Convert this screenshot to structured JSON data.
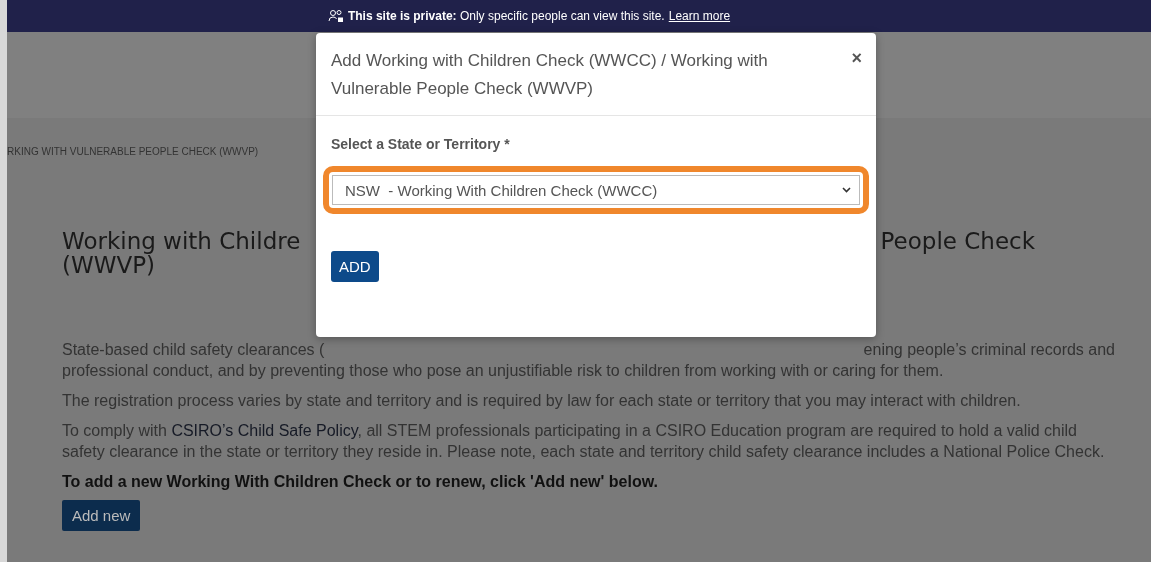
{
  "banner": {
    "bold": "This site is private:",
    "text": "Only specific people can view this site.",
    "link": "Learn more"
  },
  "breadcrumb": "RKING WITH VULNERABLE PEOPLE CHECK (WWVP)",
  "heading": {
    "line_1_left": "Working with Childre",
    "line_1_right": "People Check",
    "line_2": "(WWVP)"
  },
  "paragraphs": [
    {
      "left": "State-based child safety clearances (",
      "right": "ening people’s criminal records and"
    },
    {
      "text": "professional conduct, and by preventing those who pose an unjustifiable risk to children from working with or caring for them."
    },
    {
      "text": "The registration process varies by state and territory and is required by law for each state or territory that you may interact with children."
    },
    {
      "text": "To comply with **CSIRO’s Child Safe Policy**, all STEM professionals participating in a CSIRO Education program are required to hold a valid child safety clearance in the state or territory they reside in. Please note, each state and territory child safety clearance includes a National Police Check."
    }
  ],
  "instruction": "To add a new Working With Children Check or to renew, click 'Add new' below.",
  "add_new_button": "Add new",
  "modal": {
    "title": "Add Working with Children Check (WWCC) / Working with Vulnerable People Check (WWVP)",
    "close": "×",
    "label": "Select a State or Territory *",
    "select_value": "NSW  - Working With Children Check (WWCC)",
    "highlighted": true,
    "add_button": "ADD"
  }
}
